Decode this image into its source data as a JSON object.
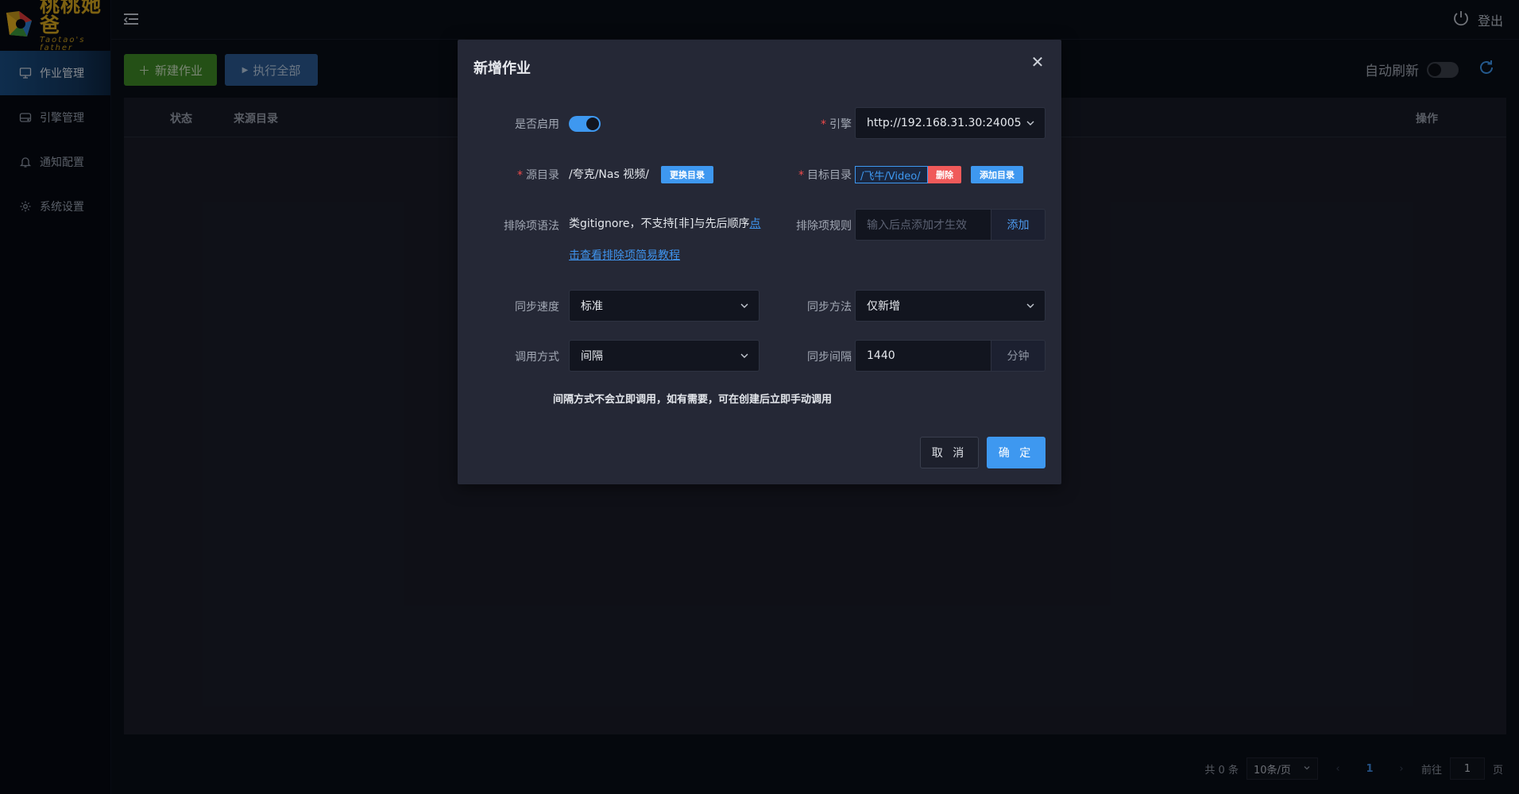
{
  "app": {
    "logo_title": "桃桃她爸",
    "logo_subtitle": "Taotao's father"
  },
  "sidebar": {
    "items": [
      {
        "label": "作业管理",
        "icon": "monitor-icon",
        "active": true
      },
      {
        "label": "引擎管理",
        "icon": "drive-icon",
        "active": false
      },
      {
        "label": "通知配置",
        "icon": "bell-icon",
        "active": false
      },
      {
        "label": "系统设置",
        "icon": "gear-icon",
        "active": false
      }
    ]
  },
  "topbar": {
    "logout_label": "登出"
  },
  "toolbar": {
    "new_job_label": "新建作业",
    "run_all_label": "执行全部",
    "auto_refresh_label": "自动刷新",
    "auto_refresh_on": false
  },
  "table": {
    "columns": [
      "状态",
      "来源目录",
      "操作"
    ]
  },
  "pager": {
    "total_label": "共 0 条",
    "page_size": "10条/页",
    "current_page": "1",
    "goto_label": "前往",
    "goto_value": "1",
    "page_suffix": "页"
  },
  "modal": {
    "title": "新增作业",
    "enabled_label": "是否启用",
    "enabled": true,
    "engine_label": "引擎",
    "engine_value": "http://192.168.31.30:24005",
    "source_label": "源目录",
    "source_value": "/夸克/Nas 视频/",
    "change_dir_label": "更换目录",
    "target_label": "目标目录",
    "target_value": "/飞牛/Video/",
    "delete_label": "删除",
    "add_dir_label": "添加目录",
    "exclude_syntax_label": "排除项语法",
    "exclude_syntax_text": "类gitignore，不支持[非]与先后顺序",
    "exclude_syntax_link_a": "点",
    "exclude_syntax_link_b": "击查看排除项简易教程",
    "exclude_rule_label": "排除项规则",
    "exclude_rule_placeholder": "输入后点添加才生效",
    "add_label": "添加",
    "sync_speed_label": "同步速度",
    "sync_speed_value": "标准",
    "sync_method_label": "同步方法",
    "sync_method_value": "仅新增",
    "call_mode_label": "调用方式",
    "call_mode_value": "间隔",
    "sync_interval_label": "同步间隔",
    "sync_interval_value": "1440",
    "interval_unit": "分钟",
    "hint": "间隔方式不会立即调用，如有需要，可在创建后立即手动调用",
    "cancel_label": "取 消",
    "ok_label": "确 定"
  },
  "colors": {
    "accent": "#3e98f0",
    "green_button": "#3e8a26",
    "danger": "#f05a5a",
    "logo_gold": "#d7a81e"
  }
}
